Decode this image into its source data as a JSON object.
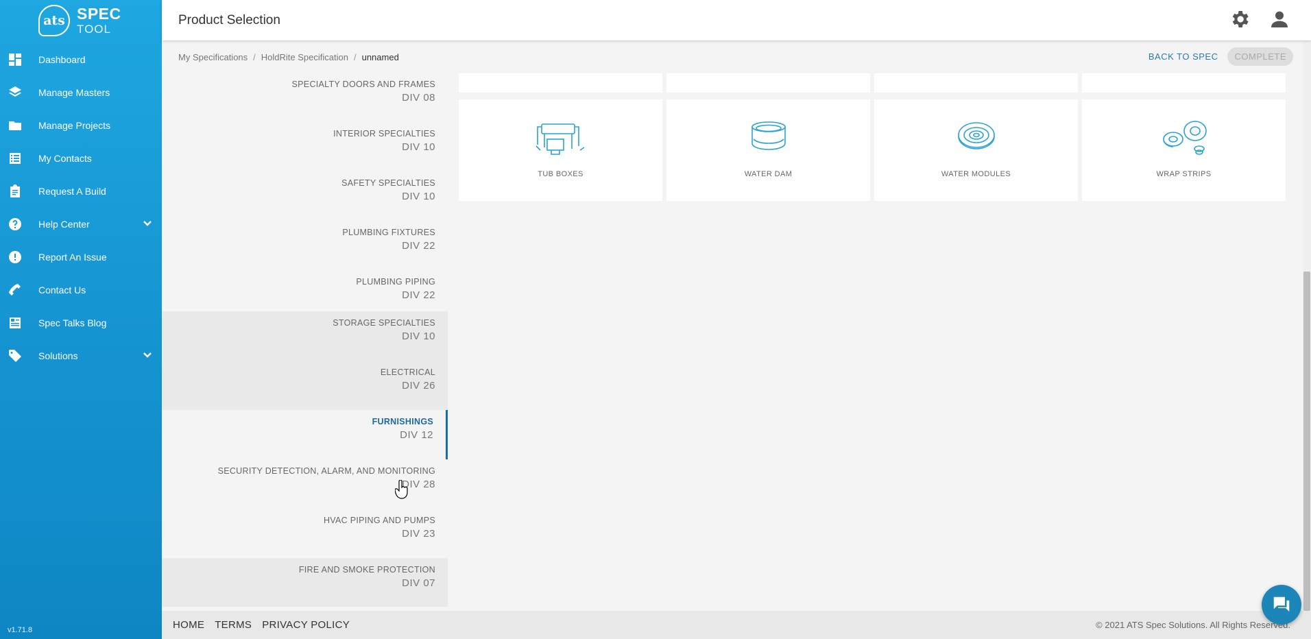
{
  "logo": {
    "badge": "ats",
    "line1": "SPEC",
    "line2": "TOOL"
  },
  "sidebar": {
    "items": [
      {
        "label": "Dashboard",
        "icon": "dashboard-icon"
      },
      {
        "label": "Manage Masters",
        "icon": "layers-icon"
      },
      {
        "label": "Manage Projects",
        "icon": "folder-icon"
      },
      {
        "label": "My Contacts",
        "icon": "contacts-list-icon"
      },
      {
        "label": "Request A Build",
        "icon": "clipboard-icon"
      },
      {
        "label": "Help Center",
        "icon": "help-circle-icon",
        "expandable": true
      },
      {
        "label": "Report An Issue",
        "icon": "alert-circle-icon"
      },
      {
        "label": "Contact Us",
        "icon": "phone-icon"
      },
      {
        "label": "Spec Talks Blog",
        "icon": "blog-icon"
      },
      {
        "label": "Solutions",
        "icon": "tag-icon",
        "expandable": true
      }
    ],
    "version": "v1.71.8"
  },
  "header": {
    "title": "Product Selection",
    "icons": [
      "gear-icon",
      "user-icon"
    ]
  },
  "breadcrumb": {
    "items": [
      "My Specifications",
      "HoldRite Specification",
      "unnamed"
    ],
    "separator": "/",
    "back_label": "BACK TO SPEC",
    "complete_label": "COMPLETE"
  },
  "divisions": [
    {
      "name": "SPECIALTY DOORS AND FRAMES",
      "code": "DIV 08"
    },
    {
      "name": "INTERIOR SPECIALTIES",
      "code": "DIV 10"
    },
    {
      "name": "SAFETY SPECIALTIES",
      "code": "DIV 10"
    },
    {
      "name": "PLUMBING FIXTURES",
      "code": "DIV 22"
    },
    {
      "name": "PLUMBING PIPING",
      "code": "DIV 22"
    },
    {
      "name": "STORAGE SPECIALTIES",
      "code": "DIV 10"
    },
    {
      "name": "ELECTRICAL",
      "code": "DIV 26"
    },
    {
      "name": "FURNISHINGS",
      "code": "DIV 12"
    },
    {
      "name": "SECURITY DETECTION, ALARM, AND MONITORING",
      "code": "DIV 28"
    },
    {
      "name": "HVAC PIPING AND PUMPS",
      "code": "DIV 23"
    },
    {
      "name": "FIRE AND SMOKE PROTECTION",
      "code": "DIV 07"
    }
  ],
  "products": [
    {
      "label": "TUB BOXES",
      "icon": "tub-box-icon"
    },
    {
      "label": "WATER DAM",
      "icon": "water-dam-icon"
    },
    {
      "label": "WATER MODULES",
      "icon": "water-module-icon"
    },
    {
      "label": "WRAP STRIPS",
      "icon": "wrap-strip-icon"
    }
  ],
  "footer": {
    "links": [
      "HOME",
      "TERMS",
      "PRIVACY POLICY"
    ],
    "copyright": "© 2021 ATS Spec Solutions. All Rights Reserved."
  },
  "colors": {
    "sidebar": "#1ea7e1",
    "accent": "#1d6b9a",
    "icon_stroke": "#29a3d6"
  }
}
